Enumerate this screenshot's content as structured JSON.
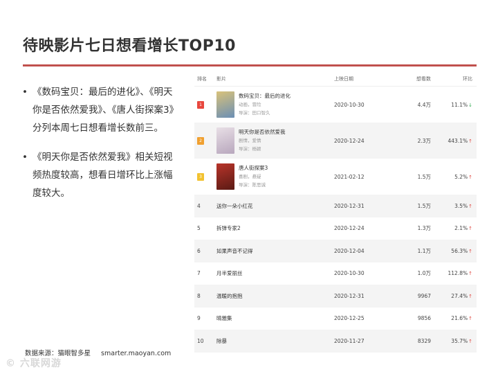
{
  "slide": {
    "title": "待映影片七日想看增长TOP10",
    "bullets": [
      "《数码宝贝：最后的进化》、《明天你是否依然爱我》、《唐人街探案3》分列本周七日想看增长数前三。",
      "《明天你是否依然爱我》相关短视频热度较高，想看日增环比上涨幅度较大。"
    ],
    "bullet_symbol": "•",
    "source_label": "数据来源：猫眼智多星",
    "source_url": "smarter.maoyan.com",
    "watermark": "© 六联网游"
  },
  "table": {
    "headers": [
      "排名",
      "影片",
      "上映日期",
      "想看数",
      "环比"
    ],
    "rows": [
      {
        "rank": "1",
        "title": "数码宝贝：最后的进化",
        "genre": "动画，冒险",
        "director": "导演：田口智久",
        "date": "2020-10-30",
        "count": "4.4万",
        "ratio": "11.1%",
        "trend": "down",
        "badge_color": "#e8473e",
        "poster_colors": [
          "#d9c27a",
          "#6b8fb5"
        ]
      },
      {
        "rank": "2",
        "title": "明天你是否依然爱我",
        "genre": "剧情，爱情",
        "director": "导演：杨颖",
        "date": "2020-12-24",
        "count": "2.3万",
        "ratio": "443.1%",
        "trend": "up",
        "badge_color": "#f0a030",
        "poster_colors": [
          "#e8dfe6",
          "#b8a7bd"
        ]
      },
      {
        "rank": "3",
        "title": "唐人街探案3",
        "genre": "喜剧，悬疑",
        "director": "导演：陈思诚",
        "date": "2021-02-12",
        "count": "1.5万",
        "ratio": "5.2%",
        "trend": "up",
        "badge_color": "#f2c230",
        "poster_colors": [
          "#b8342a",
          "#5a1a14"
        ]
      },
      {
        "rank": "4",
        "title": "送你一朵小红花",
        "date": "2020-12-31",
        "count": "1.5万",
        "ratio": "3.5%",
        "trend": "up"
      },
      {
        "rank": "5",
        "title": "拆弹专家2",
        "date": "2020-12-24",
        "count": "1.3万",
        "ratio": "2.1%",
        "trend": "up"
      },
      {
        "rank": "6",
        "title": "如果声音不记得",
        "date": "2020-12-04",
        "count": "1.1万",
        "ratio": "56.3%",
        "trend": "up"
      },
      {
        "rank": "7",
        "title": "月半爱丽丝",
        "date": "2020-10-30",
        "count": "1.0万",
        "ratio": "112.8%",
        "trend": "up"
      },
      {
        "rank": "8",
        "title": "温暖的抱抱",
        "date": "2020-12-31",
        "count": "9967",
        "ratio": "27.4%",
        "trend": "up"
      },
      {
        "rank": "9",
        "title": "晴雅集",
        "date": "2020-12-25",
        "count": "9856",
        "ratio": "21.6%",
        "trend": "up"
      },
      {
        "rank": "10",
        "title": "除暴",
        "date": "2020-11-27",
        "count": "8329",
        "ratio": "35.7%",
        "trend": "up"
      }
    ],
    "trend_up_icon": "↑",
    "trend_down_icon": "↓"
  }
}
